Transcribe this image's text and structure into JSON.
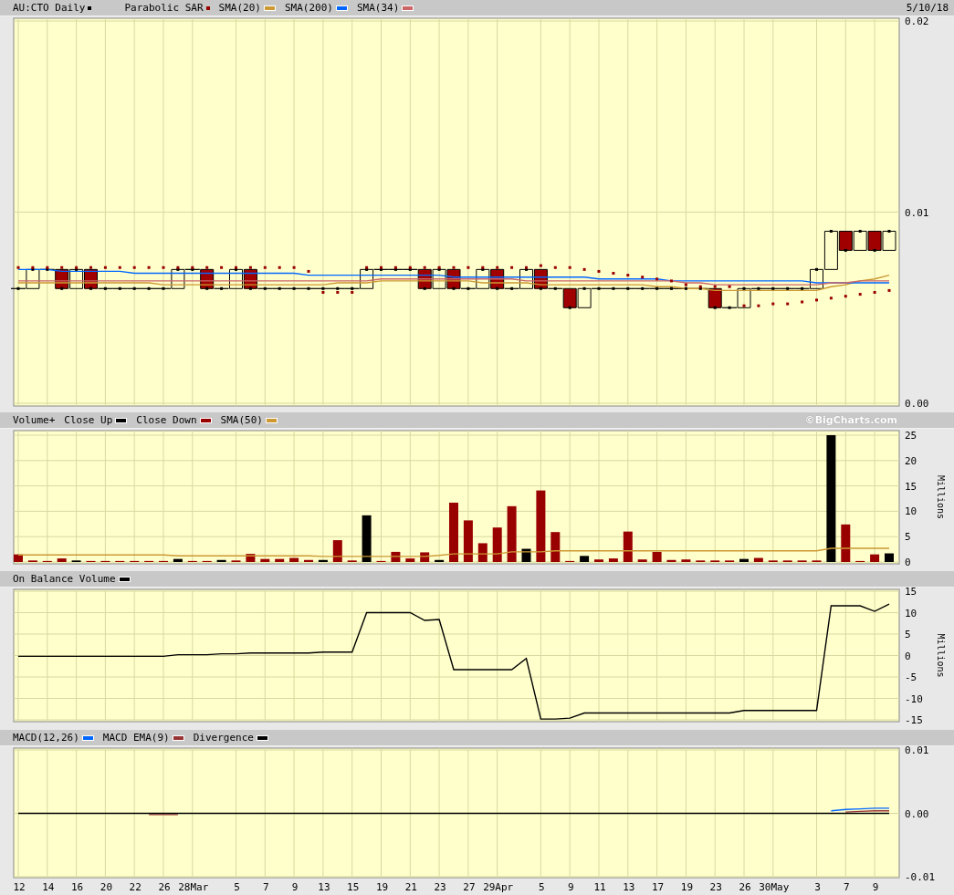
{
  "panels": [
    {
      "date": "5/10/18",
      "chart_data": {
        "type": "line",
        "grid": true,
        "legend": "top",
        "ylim": [
          0,
          0.02
        ],
        "yticks": [
          {
            "value": 0,
            "label": "0.00"
          },
          {
            "value": 0.01,
            "label": "0.01"
          },
          {
            "value": 0.02,
            "label": "0.02"
          }
        ],
        "series": [
          {
            "name": "AU:CTO Daily",
            "type": "scatter",
            "marker": "square",
            "color": "#000000",
            "values": [
              0.006,
              0.007,
              0.007,
              0.006,
              0.007,
              0.006,
              0.006,
              0.006,
              0.006,
              0.006,
              0.006,
              0.007,
              0.007,
              0.006,
              0.006,
              0.007,
              0.006,
              0.006,
              0.006,
              0.006,
              0.006,
              0.006,
              0.006,
              0.006,
              0.007,
              0.007,
              0.007,
              0.007,
              0.006,
              0.007,
              0.006,
              0.006,
              0.007,
              0.006,
              0.006,
              0.007,
              0.006,
              0.006,
              0.005,
              0.006,
              0.006,
              0.006,
              0.006,
              0.006,
              0.006,
              0.006,
              0.006,
              0.006,
              0.005,
              0.005,
              0.006,
              0.006,
              0.006,
              0.006,
              0.006,
              0.007,
              0.009,
              0.008,
              0.009,
              0.008,
              0.009
            ]
          },
          {
            "name": "Parabolic SAR",
            "type": "scatter",
            "marker": "square",
            "color": "#990000",
            "values": [
              0.0071,
              0.0071,
              0.0071,
              0.0071,
              0.0071,
              0.0071,
              0.0071,
              0.0071,
              0.0071,
              0.0071,
              0.0071,
              0.0071,
              0.0071,
              0.0071,
              0.0071,
              0.0071,
              0.0071,
              0.0071,
              0.0071,
              0.0071,
              0.0069,
              0.0058,
              0.0058,
              0.0058,
              0.0071,
              0.0071,
              0.0071,
              0.0071,
              0.0071,
              0.0071,
              0.0071,
              0.0071,
              0.0071,
              0.0071,
              0.0071,
              0.0071,
              0.0072,
              0.0071,
              0.0071,
              0.007,
              0.0069,
              0.0068,
              0.0067,
              0.0066,
              0.0065,
              0.0064,
              0.0062,
              0.0061,
              0.0061,
              0.0061,
              0.0051,
              0.0051,
              0.0052,
              0.0052,
              0.0053,
              0.0054,
              0.0055,
              0.0056,
              0.0057,
              0.0058,
              0.0059
            ]
          },
          {
            "name": "SMA(20)",
            "color": "#cc9933",
            "values": [
              0.0063,
              0.0063,
              0.0063,
              0.0063,
              0.0063,
              0.0063,
              0.0063,
              0.0063,
              0.0063,
              0.0063,
              0.0062,
              0.0062,
              0.0062,
              0.0062,
              0.0062,
              0.0062,
              0.0062,
              0.0062,
              0.0062,
              0.0062,
              0.0062,
              0.0062,
              0.0063,
              0.0063,
              0.0063,
              0.0064,
              0.0064,
              0.0064,
              0.0064,
              0.0064,
              0.0064,
              0.0064,
              0.0063,
              0.0063,
              0.0063,
              0.0063,
              0.0062,
              0.0062,
              0.0062,
              0.0062,
              0.0062,
              0.0062,
              0.0062,
              0.0062,
              0.0061,
              0.0061,
              0.006,
              0.006,
              0.0059,
              0.0059,
              0.0059,
              0.0059,
              0.0059,
              0.0059,
              0.0059,
              0.0059,
              0.0061,
              0.0062,
              0.0064,
              0.0065,
              0.0067
            ]
          },
          {
            "name": "SMA(200)",
            "color": "#0066ff",
            "values": [
              0.007,
              0.007,
              0.007,
              0.0069,
              0.0069,
              0.0069,
              0.0069,
              0.0069,
              0.0068,
              0.0068,
              0.0068,
              0.0068,
              0.0068,
              0.0068,
              0.0068,
              0.0068,
              0.0068,
              0.0068,
              0.0068,
              0.0068,
              0.0067,
              0.0067,
              0.0067,
              0.0067,
              0.0067,
              0.0067,
              0.0067,
              0.0067,
              0.0067,
              0.0067,
              0.0066,
              0.0066,
              0.0066,
              0.0066,
              0.0066,
              0.0066,
              0.0066,
              0.0066,
              0.0066,
              0.0066,
              0.0065,
              0.0065,
              0.0065,
              0.0065,
              0.0065,
              0.0064,
              0.0064,
              0.0064,
              0.0064,
              0.0064,
              0.0064,
              0.0064,
              0.0064,
              0.0064,
              0.0064,
              0.0063,
              0.0063,
              0.0063,
              0.0063,
              0.0063,
              0.0063
            ]
          },
          {
            "name": "SMA(34)",
            "color": "#cc6666",
            "values": [
              0.0064,
              0.0064,
              0.0064,
              0.0064,
              0.0064,
              0.0064,
              0.0064,
              0.0064,
              0.0064,
              0.0064,
              0.0064,
              0.0064,
              0.0064,
              0.0064,
              0.0064,
              0.0064,
              0.0064,
              0.0064,
              0.0064,
              0.0064,
              0.0064,
              0.0064,
              0.0064,
              0.0064,
              0.0064,
              0.0065,
              0.0065,
              0.0065,
              0.0065,
              0.0065,
              0.0065,
              0.0065,
              0.0065,
              0.0065,
              0.0065,
              0.0064,
              0.0064,
              0.0064,
              0.0064,
              0.0064,
              0.0064,
              0.0064,
              0.0064,
              0.0064,
              0.0064,
              0.0064,
              0.0063,
              0.0063,
              0.0062,
              0.0062,
              0.0062,
              0.0062,
              0.0062,
              0.0062,
              0.0062,
              0.0062,
              0.0063,
              0.0063,
              0.0064,
              0.0064,
              0.0064
            ]
          }
        ]
      }
    },
    {
      "credit": "©BigCharts.com",
      "chart_data": {
        "type": "bar",
        "grid": true,
        "legend": "top",
        "title": "Volume+",
        "ylabel": "Millions",
        "ylim": [
          0,
          25
        ],
        "yticks": [
          0,
          5,
          10,
          15,
          20,
          25
        ],
        "series": [
          {
            "name": "Close Up",
            "color": "#000000",
            "values": [
              null,
              null,
              null,
              null,
              0.3,
              null,
              null,
              null,
              null,
              null,
              null,
              0.6,
              null,
              null,
              0.4,
              null,
              null,
              null,
              null,
              null,
              null,
              0.4,
              null,
              null,
              9.2,
              null,
              null,
              null,
              null,
              0.4,
              null,
              null,
              null,
              null,
              null,
              2.6,
              null,
              null,
              null,
              1.2,
              null,
              null,
              null,
              null,
              null,
              null,
              null,
              null,
              null,
              null,
              0.6,
              null,
              null,
              null,
              null,
              null,
              25,
              null,
              null,
              null,
              1.7
            ]
          },
          {
            "name": "Close Down",
            "color": "#990000",
            "values": [
              1.5,
              0.3,
              0.2,
              0.7,
              null,
              0.2,
              0.2,
              0.2,
              0.2,
              0.2,
              0.2,
              null,
              0.2,
              0.2,
              null,
              0.3,
              1.6,
              0.6,
              0.6,
              0.8,
              0.4,
              null,
              4.3,
              0.3,
              null,
              0.2,
              2.0,
              0.7,
              1.9,
              null,
              11.7,
              8.2,
              3.7,
              6.8,
              11.0,
              null,
              14.1,
              5.9,
              0.2,
              null,
              0.5,
              0.7,
              6.0,
              0.5,
              2.0,
              0.4,
              0.5,
              0.3,
              0.3,
              0.3,
              null,
              0.8,
              0.3,
              0.3,
              0.3,
              0.3,
              null,
              7.4,
              0.2,
              1.5,
              null
            ]
          },
          {
            "name": "SMA(50)",
            "type": "line",
            "color": "#cc9933",
            "values": [
              1.4,
              1.4,
              1.4,
              1.4,
              1.4,
              1.4,
              1.4,
              1.4,
              1.4,
              1.4,
              1.4,
              1.2,
              1.2,
              1.2,
              1.2,
              1.2,
              1.2,
              1.2,
              1.2,
              1.2,
              1.2,
              1.1,
              1.1,
              1.1,
              1.1,
              1.1,
              1.1,
              1.1,
              1.1,
              1.3,
              1.6,
              1.6,
              1.6,
              1.6,
              2.0,
              2.0,
              2.0,
              2.2,
              2.2,
              2.2,
              2.2,
              2.2,
              2.2,
              2.2,
              2.2,
              2.2,
              2.2,
              2.2,
              2.2,
              2.2,
              2.2,
              2.2,
              2.2,
              2.2,
              2.2,
              2.2,
              2.7,
              2.7,
              2.7,
              2.7,
              2.7
            ]
          }
        ]
      }
    },
    {
      "chart_data": {
        "type": "line",
        "grid": true,
        "legend": "top",
        "ylabel": "Millions",
        "ylim": [
          -15,
          15
        ],
        "yticks": [
          15,
          10,
          5,
          0,
          -5,
          -10,
          -15
        ],
        "series": [
          {
            "name": "On Balance Volume",
            "color": "#000000",
            "values": [
              -0.2,
              -0.2,
              -0.2,
              -0.2,
              -0.2,
              -0.2,
              -0.2,
              -0.2,
              -0.2,
              -0.2,
              -0.2,
              0.2,
              0.2,
              0.2,
              0.4,
              0.4,
              0.6,
              0.6,
              0.6,
              0.6,
              0.6,
              0.8,
              0.8,
              0.8,
              10,
              10,
              10,
              10,
              8.2,
              8.4,
              -3.3,
              -3.3,
              -3.3,
              -3.3,
              -3.3,
              -0.7,
              -14.8,
              -14.8,
              -14.6,
              -13.4,
              -13.4,
              -13.4,
              -13.4,
              -13.4,
              -13.4,
              -13.4,
              -13.4,
              -13.4,
              -13.4,
              -13.4,
              -12.8,
              -12.8,
              -12.8,
              -12.8,
              -12.8,
              -12.8,
              11.6,
              11.6,
              11.6,
              10.3,
              12
            ]
          }
        ]
      }
    },
    {
      "chart_data": {
        "type": "line",
        "grid": true,
        "legend": "top",
        "ylim": [
          -0.01,
          0.01
        ],
        "yticks": [
          {
            "value": 0.01,
            "label": "0.01"
          },
          {
            "value": 0,
            "label": "0.00"
          },
          {
            "value": -0.01,
            "label": "-0.01"
          }
        ],
        "categories": [
          "12",
          null,
          "14",
          null,
          "16",
          null,
          "20",
          null,
          "22",
          null,
          "26",
          null,
          "28Mar",
          null,
          null,
          "5",
          null,
          "7",
          null,
          "9",
          null,
          "13",
          null,
          "15",
          null,
          "19",
          null,
          "21",
          null,
          "23",
          null,
          "27",
          null,
          "29Apr",
          null,
          null,
          "5",
          null,
          "9",
          null,
          "11",
          null,
          "13",
          null,
          "17",
          null,
          "19",
          null,
          "23",
          null,
          "26",
          null,
          "30May",
          null,
          null,
          "3",
          null,
          "7",
          null,
          "9",
          null
        ],
        "series": [
          {
            "name": "MACD(12,26)",
            "color": "#0066ff",
            "values": [
              null,
              null,
              null,
              null,
              null,
              null,
              null,
              null,
              null,
              null,
              null,
              null,
              null,
              null,
              null,
              null,
              null,
              null,
              null,
              null,
              null,
              null,
              null,
              null,
              null,
              null,
              null,
              null,
              null,
              null,
              null,
              null,
              null,
              null,
              null,
              null,
              null,
              null,
              null,
              null,
              null,
              null,
              null,
              null,
              null,
              null,
              null,
              null,
              null,
              null,
              null,
              null,
              null,
              null,
              null,
              null,
              0.0004,
              0.0006,
              0.0007,
              0.0008,
              0.0008
            ]
          },
          {
            "name": "MACD EMA(9)",
            "color": "#993333",
            "values": [
              null,
              null,
              null,
              null,
              null,
              null,
              null,
              null,
              null,
              -0.0002,
              -0.0002,
              -0.0002,
              null,
              null,
              null,
              null,
              null,
              null,
              null,
              null,
              null,
              null,
              null,
              null,
              null,
              null,
              null,
              null,
              null,
              null,
              null,
              null,
              null,
              null,
              null,
              null,
              null,
              null,
              null,
              null,
              null,
              null,
              null,
              null,
              null,
              null,
              null,
              null,
              null,
              null,
              null,
              null,
              null,
              null,
              null,
              null,
              null,
              0.0002,
              0.0003,
              0.0004,
              0.0004
            ]
          },
          {
            "name": "Divergence",
            "color": "#000000",
            "values": [
              0,
              0,
              0,
              0,
              0,
              0,
              0,
              0,
              0,
              0,
              0,
              0,
              0,
              0,
              0,
              0,
              0,
              0,
              0,
              0,
              0,
              0,
              0,
              0,
              0,
              0,
              0,
              0,
              0,
              0,
              0,
              0,
              0,
              0,
              0,
              0,
              0,
              0,
              0,
              0,
              0,
              0,
              0,
              0,
              0,
              0,
              0,
              0,
              0,
              0,
              0,
              0,
              0,
              0,
              0,
              0,
              0,
              0,
              0,
              0,
              0
            ]
          }
        ]
      }
    }
  ]
}
